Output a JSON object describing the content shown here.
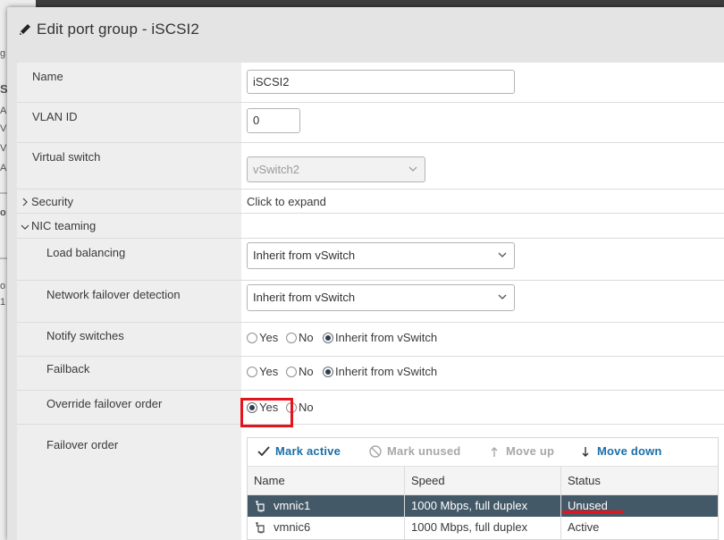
{
  "background": {
    "fragments": [
      "g",
      "S",
      "A",
      "V",
      "V",
      "A",
      "o",
      "o",
      "1"
    ]
  },
  "dialog": {
    "title": "Edit port group - iSCSI2",
    "icon": "pencil-icon"
  },
  "fields": {
    "name_label": "Name",
    "name_value": "iSCSI2",
    "vlan_label": "VLAN ID",
    "vlan_value": "0",
    "vswitch_label": "Virtual switch",
    "vswitch_value": "vSwitch2",
    "security_label": "Security",
    "security_value": "Click to expand",
    "nic_teaming_label": "NIC teaming",
    "load_balancing_label": "Load balancing",
    "load_balancing_value": "Inherit from vSwitch",
    "failover_detection_label": "Network failover detection",
    "failover_detection_value": "Inherit from vSwitch",
    "notify_label": "Notify switches",
    "failback_label": "Failback",
    "override_label": "Override failover order",
    "failover_order_label": "Failover order"
  },
  "radios": {
    "yes": "Yes",
    "no": "No",
    "inherit": "Inherit from vSwitch",
    "notify_selected": "inherit",
    "failback_selected": "inherit",
    "override_selected": "yes"
  },
  "toolbar": {
    "mark_active": "Mark active",
    "mark_unused": "Mark unused",
    "move_up": "Move up",
    "move_down": "Move down"
  },
  "table": {
    "columns": [
      "Name",
      "Speed",
      "Status"
    ],
    "rows": [
      {
        "name": "vmnic1",
        "speed": "1000 Mbps, full duplex",
        "status": "Unused",
        "selected": true
      },
      {
        "name": "vmnic6",
        "speed": "1000 Mbps, full duplex",
        "status": "Active",
        "selected": false
      }
    ]
  },
  "colors": {
    "accent": "#1b6fa8",
    "selected_row": "#445968",
    "annotation_red": "#e3141d"
  }
}
